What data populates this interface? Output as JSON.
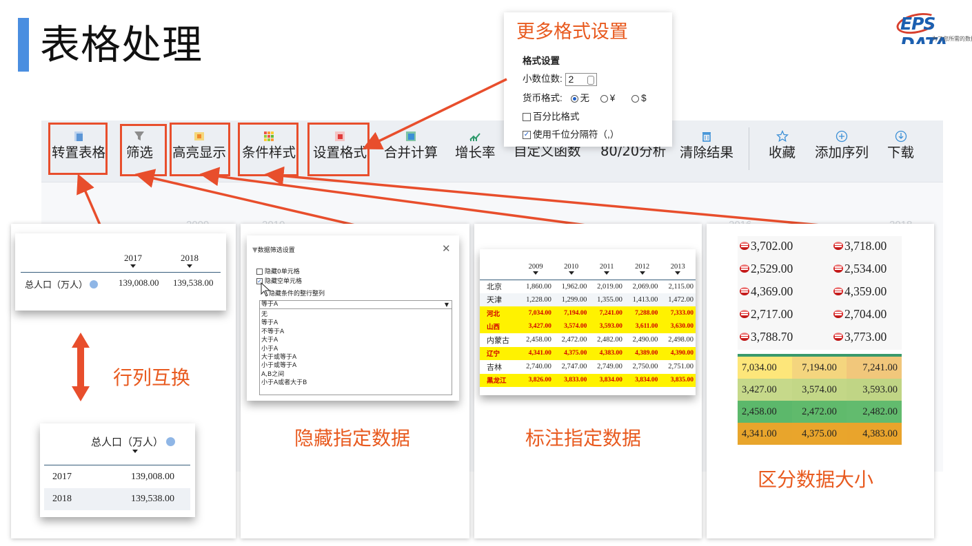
{
  "title": "表格处理",
  "logo": {
    "text": "EPS DATA",
    "tagline": "为了您所需的数据"
  },
  "toolbar": {
    "items": [
      {
        "label": "转置表格",
        "icon": "transpose-table-icon"
      },
      {
        "label": "筛选",
        "icon": "filter-funnel-icon"
      },
      {
        "label": "高亮显示",
        "icon": "highlight-icon"
      },
      {
        "label": "条件样式",
        "icon": "conditional-style-icon"
      },
      {
        "label": "设置格式",
        "icon": "format-settings-icon"
      },
      {
        "label": "合并计算",
        "icon": "merge-calc-icon"
      },
      {
        "label": "增长率",
        "icon": "growth-rate-icon"
      },
      {
        "label": "自定义函数",
        "icon": ""
      },
      {
        "label": "80/20分析",
        "icon": ""
      },
      {
        "label": "清除结果",
        "icon": "trash-icon"
      },
      {
        "label": "收藏",
        "icon": "star-icon"
      },
      {
        "label": "添加序列",
        "icon": "plus-circle-icon"
      },
      {
        "label": "下载",
        "icon": "download-icon"
      }
    ],
    "background_years": [
      "2009",
      "2010",
      "2011",
      "2012",
      "2013",
      "2014",
      "2015",
      "2016",
      "2017",
      "2018"
    ]
  },
  "format_popup": {
    "title": "更多格式设置",
    "heading": "格式设置",
    "decimals_label": "小数位数:",
    "decimals_value": "2",
    "currency_label": "货币格式:",
    "currency_options": [
      "无",
      "¥",
      "$"
    ],
    "currency_selected": "无",
    "percent_label": "百分比格式",
    "percent_checked": false,
    "thousands_label": "使用千位分隔符（,）",
    "thousands_checked": true
  },
  "panel_transpose": {
    "top_table": {
      "headers": [
        "2017",
        "2018"
      ],
      "row_label": "总人口（万人）",
      "values": [
        "139,008.00",
        "139,538.00"
      ]
    },
    "caption": "行列互换",
    "bottom_table": {
      "header": "总人口（万人）",
      "rows": [
        {
          "year": "2017",
          "value": "139,008.00"
        },
        {
          "year": "2018",
          "value": "139,538.00"
        }
      ]
    }
  },
  "panel_filter": {
    "dialog_title": "数据筛选设置",
    "close_symbol": "✕",
    "opt_hide_zero": "隐藏0单元格",
    "opt_hide_zero_checked": false,
    "opt_hide_empty": "隐藏空单元格",
    "opt_hide_empty_checked": true,
    "opt_hide_rows": "隐藏条件的整行整列",
    "select_value": "等于A",
    "options": [
      "无",
      "等于A",
      "不等于A",
      "大于A",
      "小于A",
      "大于或等于A",
      "小于或等于A",
      "A,B之间",
      "小于A或者大于B"
    ],
    "caption": "隐藏指定数据"
  },
  "panel_highlight": {
    "headers": [
      "2009",
      "2010",
      "2011",
      "2012",
      "2013"
    ],
    "rows": [
      {
        "region": "北京",
        "values": [
          "1,860.00",
          "1,962.00",
          "2,019.00",
          "2,069.00",
          "2,115.00"
        ],
        "highlight": false
      },
      {
        "region": "天津",
        "values": [
          "1,228.00",
          "1,299.00",
          "1,355.00",
          "1,413.00",
          "1,472.00"
        ],
        "highlight": false
      },
      {
        "region": "河北",
        "values": [
          "7,034.00",
          "7,194.00",
          "7,241.00",
          "7,288.00",
          "7,333.00"
        ],
        "highlight": true
      },
      {
        "region": "山西",
        "values": [
          "3,427.00",
          "3,574.00",
          "3,593.00",
          "3,611.00",
          "3,630.00"
        ],
        "highlight": true
      },
      {
        "region": "内蒙古",
        "values": [
          "2,458.00",
          "2,472.00",
          "2,482.00",
          "2,490.00",
          "2,498.00"
        ],
        "highlight": false
      },
      {
        "region": "辽宁",
        "values": [
          "4,341.00",
          "4,375.00",
          "4,383.00",
          "4,389.00",
          "4,390.00"
        ],
        "highlight": true
      },
      {
        "region": "吉林",
        "values": [
          "2,740.00",
          "2,747.00",
          "2,749.00",
          "2,750.00",
          "2,751.00"
        ],
        "highlight": false
      },
      {
        "region": "黑龙江",
        "values": [
          "3,826.00",
          "3,833.00",
          "3,834.00",
          "3,834.00",
          "3,835.00"
        ],
        "highlight": true
      }
    ],
    "caption": "标注指定数据"
  },
  "panel_size": {
    "icon_rows": [
      [
        "3,702.00",
        "3,718.00"
      ],
      [
        "2,529.00",
        "2,534.00"
      ],
      [
        "4,369.00",
        "4,359.00"
      ],
      [
        "2,717.00",
        "2,704.00"
      ],
      [
        "3,788.70",
        "3,773.00"
      ]
    ],
    "color_rows": [
      {
        "values": [
          "7,034.00",
          "7,194.00",
          "7,241.00"
        ],
        "colors": [
          "#fde67a",
          "#f4d57e",
          "#f1c77b"
        ]
      },
      {
        "values": [
          "3,427.00",
          "3,574.00",
          "3,593.00"
        ],
        "colors": [
          "#c6d98a",
          "#c3d787",
          "#c0d585"
        ]
      },
      {
        "values": [
          "2,458.00",
          "2,472.00",
          "2,482.00"
        ],
        "colors": [
          "#5cb86b",
          "#60ba6c",
          "#62bb6e"
        ]
      },
      {
        "values": [
          "4,341.00",
          "4,375.00",
          "4,383.00"
        ],
        "colors": [
          "#e8a52c",
          "#e9a52c",
          "#e9a42c"
        ]
      }
    ],
    "caption": "区分数据大小"
  },
  "colors": {
    "accent_orange": "#e84e2c",
    "title_blue": "#4a8ee0",
    "highlight_yellow": "#fff200"
  }
}
